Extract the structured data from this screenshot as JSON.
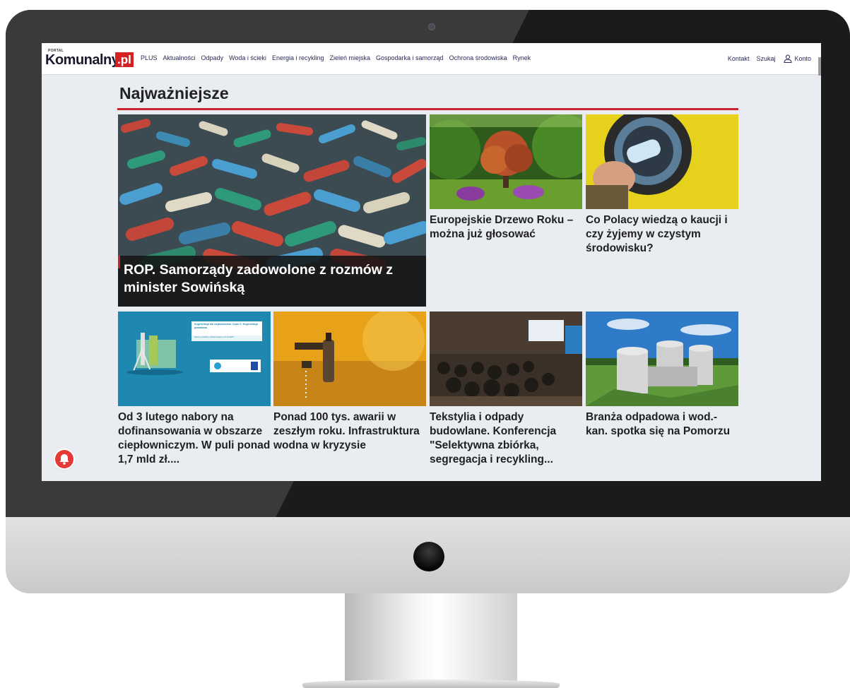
{
  "site": {
    "logo_portal": "PORTAL",
    "logo_main": "Komunalny",
    "logo_tld": ".pl"
  },
  "nav": {
    "items": [
      "PLUS",
      "Aktualności",
      "Odpady",
      "Woda i ścieki",
      "Energia i recykling",
      "Zieleń miejska",
      "Gospodarka i samorząd",
      "Ochrona środowiska",
      "Rynek"
    ],
    "contact": "Kontakt",
    "search": "Szukaj",
    "account": "Konto"
  },
  "section": {
    "title": "Najważniejsze"
  },
  "articles": {
    "hero": {
      "title": "ROP. Samorządy zadowolone z rozmów z minister Sowińską",
      "image": "plastic-bottles"
    },
    "top_1": {
      "title": "Europejskie Drzewo Roku – można już głosować",
      "image": "park-tree"
    },
    "top_2": {
      "title": "Co Polacy wiedzą o kaucji i czy żyjemy w czystym środowisku?",
      "image": "bottle-deposit-machine"
    },
    "row_1": {
      "title": "Od 3 lutego nabory na dofinansowania w obszarze ciepłowniczym. W puli ponad 1,7 mld zł....",
      "image": "cogeneration-banner"
    },
    "row_2": {
      "title": "Ponad 100 tys. awarii w zeszłym roku. Infrastruktura wodna w kryzysie",
      "image": "water-tap"
    },
    "row_3": {
      "title": "Tekstylia i odpady budowlane. Konferencja \"Selektywna zbiórka, segregacja i recykling...",
      "image": "conference-hall"
    },
    "row_4": {
      "title": "Branża odpadowa i wod.-kan. spotka się na Pomorzu",
      "image": "treatment-plant"
    }
  },
  "banner_text": {
    "line1": "Kogeneracja dla ciepłownictwa. Część 1: Kogeneracja powiatowa",
    "line2": "Nabory wniosków o dofinansowanie od 3.02.2025 r."
  },
  "icons": {
    "notification": "bell-icon",
    "account": "user-icon"
  },
  "colors": {
    "accent": "#c9232c",
    "nav_text": "#2a2a5a",
    "screen_bg": "#e9edf1"
  }
}
